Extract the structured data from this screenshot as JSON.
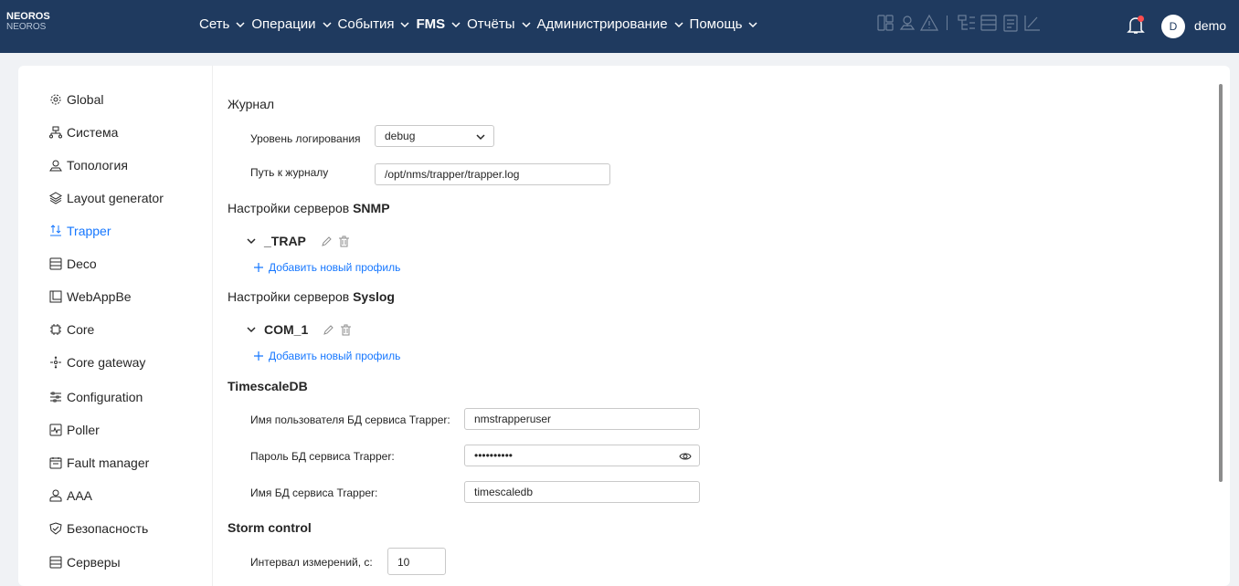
{
  "brand": {
    "name": "NEOROS",
    "sub": "NEOROS"
  },
  "menu": [
    {
      "label": "Сеть"
    },
    {
      "label": "Операции"
    },
    {
      "label": "События"
    },
    {
      "label": "FMS"
    },
    {
      "label": "Отчёты"
    },
    {
      "label": "Администрирование"
    },
    {
      "label": "Помощь"
    }
  ],
  "user": {
    "avatar": "D",
    "name": "demo"
  },
  "sidebar": {
    "items": [
      {
        "label": "Global",
        "icon": "gear-icon"
      },
      {
        "label": "Система",
        "icon": "hierarchy-icon"
      },
      {
        "label": "Топология",
        "icon": "map-pin-icon"
      },
      {
        "label": "Layout generator",
        "icon": "layers-icon"
      },
      {
        "label": "Trapper",
        "icon": "trapper-icon",
        "active": true
      },
      {
        "label": "Deco",
        "icon": "table-icon"
      },
      {
        "label": "WebAppBe",
        "icon": "app-icon"
      },
      {
        "label": "Core",
        "icon": "chip-icon"
      },
      {
        "label": "Core gateway",
        "icon": "gateway-icon"
      },
      {
        "label": "Configuration",
        "icon": "sliders-icon"
      },
      {
        "label": "Poller",
        "icon": "pulse-icon"
      },
      {
        "label": "Fault manager",
        "icon": "calendar-icon"
      },
      {
        "label": "AAA",
        "icon": "user-icon"
      },
      {
        "label": "Безопасность",
        "icon": "shield-icon"
      },
      {
        "label": "Серверы",
        "icon": "server-icon"
      }
    ]
  },
  "journal": {
    "title": "Журнал",
    "level_label": "Уровень логирования",
    "level_value": "debug",
    "path_label": "Путь к журналу",
    "path_value": "/opt/nms/trapper/trapper.log"
  },
  "snmp": {
    "title_prefix": "Настройки серверов",
    "title_bold": "SNMP",
    "profile": "_TRAP",
    "add_label": "Добавить новый профиль"
  },
  "syslog": {
    "title_prefix": "Настройки серверов",
    "title_bold": "Syslog",
    "profile": "COM_1",
    "add_label": "Добавить новый профиль"
  },
  "timescale": {
    "title": "TimescaleDB",
    "user_label": "Имя пользователя БД сервиса Trapper:",
    "user_value": "nmstrapperuser",
    "password_label": "Пароль БД сервиса Trapper:",
    "password_value": "••••••••••",
    "db_label": "Имя БД сервиса Trapper:",
    "db_value": "timescaledb"
  },
  "storm": {
    "title": "Storm control",
    "interval_label": "Интервал измерений, с:",
    "interval_value": "10"
  },
  "colors": {
    "topbar": "#1f3a5f",
    "accent": "#1677ff",
    "badge": "#ff4d4f"
  }
}
